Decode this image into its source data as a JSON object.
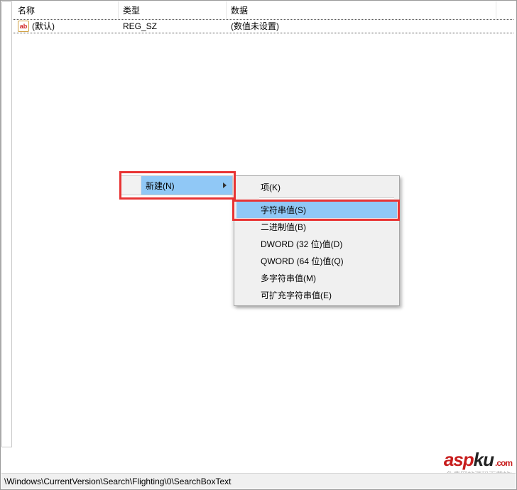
{
  "columns": {
    "name": "名称",
    "type": "类型",
    "data": "数据"
  },
  "row": {
    "name": "(默认)",
    "type": "REG_SZ",
    "data": "(数值未设置)",
    "icon": "ab"
  },
  "menu": {
    "parent": "新建(N)",
    "items": [
      {
        "label": "项(K)",
        "selected": false
      },
      {
        "sep": true
      },
      {
        "label": "字符串值(S)",
        "selected": true
      },
      {
        "label": "二进制值(B)",
        "selected": false
      },
      {
        "label": "DWORD (32 位)值(D)",
        "selected": false
      },
      {
        "label": "QWORD (64 位)值(Q)",
        "selected": false
      },
      {
        "label": "多字符串值(M)",
        "selected": false
      },
      {
        "label": "可扩充字符串值(E)",
        "selected": false
      }
    ]
  },
  "statusbar": "\\Windows\\CurrentVersion\\Search\\Flighting\\0\\SearchBoxText",
  "watermark": {
    "a": "asp",
    "k": "ku",
    "com": ".com",
    "sub": "免费网站源码下载站!"
  }
}
